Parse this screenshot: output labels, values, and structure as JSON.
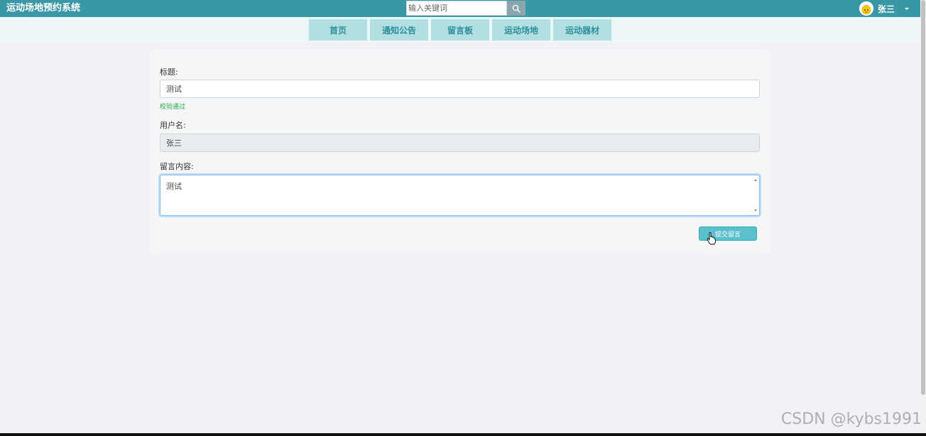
{
  "header": {
    "brand": "运动场地预约系统",
    "search": {
      "placeholder": "输入关键词",
      "value": ""
    },
    "user": {
      "name": "张三"
    }
  },
  "nav": {
    "items": [
      {
        "label": "首页"
      },
      {
        "label": "通知公告"
      },
      {
        "label": "留言板"
      },
      {
        "label": "运动场地"
      },
      {
        "label": "运动器材"
      }
    ]
  },
  "form": {
    "title_label": "标题:",
    "title_value": "测试",
    "title_validation": "校验通过",
    "username_label": "用户名:",
    "username_value": "张三",
    "content_label": "留言内容:",
    "content_value": "测试",
    "submit_label": "提交留言"
  },
  "watermark": "CSDN @kybs1991",
  "colors": {
    "header_bg": "#3a97a5",
    "nav_item_bg": "#b2e0e2",
    "nav_item_text": "#2e8f9c",
    "submit_bg": "#5bc0ce",
    "valid_text": "#28a745"
  }
}
